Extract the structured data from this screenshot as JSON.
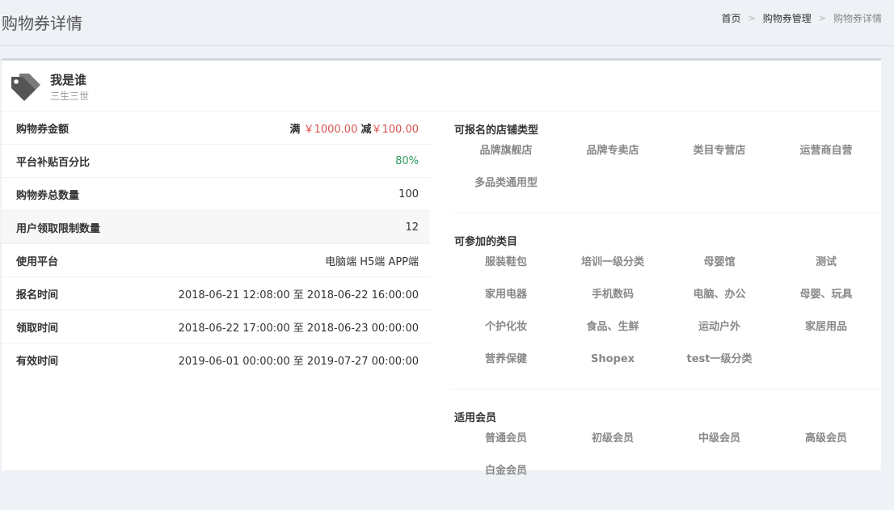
{
  "header": {
    "title": "购物券详情",
    "breadcrumb": [
      "首页",
      "购物券管理",
      "购物券详情"
    ]
  },
  "panel": {
    "title": "我是谁",
    "subtitle": "三生三世",
    "icon": "tags-icon"
  },
  "details": [
    {
      "label": "购物券金额",
      "value_parts": [
        "满",
        "￥1000.00",
        "减",
        "￥100.00"
      ]
    },
    {
      "label": "平台补贴百分比",
      "value": "80%"
    },
    {
      "label": "购物券总数量",
      "value": "100"
    },
    {
      "label": "用户领取限制数量",
      "value": "12"
    },
    {
      "label": "使用平台",
      "value": "电脑端 H5端 APP端"
    },
    {
      "label": "报名时间",
      "value": "2018-06-21 12:08:00 至 2018-06-22 16:00:00"
    },
    {
      "label": "领取时间",
      "value": "2018-06-22 17:00:00 至 2018-06-23 00:00:00"
    },
    {
      "label": "有效时间",
      "value": "2019-06-01 00:00:00 至 2019-07-27 00:00:00"
    }
  ],
  "store_types": {
    "title": "可报名的店铺类型",
    "items": [
      "品牌旗舰店",
      "品牌专卖店",
      "类目专营店",
      "运营商自营",
      "多品类通用型"
    ]
  },
  "categories": {
    "title": "可参加的类目",
    "items": [
      "服装鞋包",
      "培训一级分类",
      "母婴馆",
      "测试",
      "家用电器",
      "手机数码",
      "电脑、办公",
      "母婴、玩具",
      "个护化妆",
      "食品、生鲜",
      "运动户外",
      "家居用品",
      "营养保健",
      "Shopex",
      "test一级分类"
    ]
  },
  "members": {
    "title": "适用会员",
    "items": [
      "普通会员",
      "初级会员",
      "中级会员",
      "高级会员",
      "白金会员"
    ]
  },
  "colors": {
    "accent_red": "#d9534f",
    "accent_green": "#2e9a61",
    "muted": "#888888"
  }
}
